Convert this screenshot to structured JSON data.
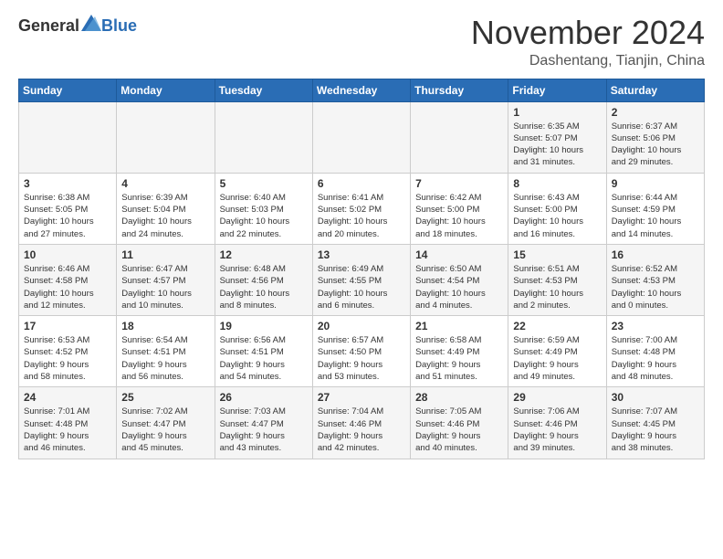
{
  "header": {
    "logo_general": "General",
    "logo_blue": "Blue",
    "month": "November 2024",
    "location": "Dashentang, Tianjin, China"
  },
  "weekdays": [
    "Sunday",
    "Monday",
    "Tuesday",
    "Wednesday",
    "Thursday",
    "Friday",
    "Saturday"
  ],
  "weeks": [
    [
      {
        "day": "",
        "info": ""
      },
      {
        "day": "",
        "info": ""
      },
      {
        "day": "",
        "info": ""
      },
      {
        "day": "",
        "info": ""
      },
      {
        "day": "",
        "info": ""
      },
      {
        "day": "1",
        "info": "Sunrise: 6:35 AM\nSunset: 5:07 PM\nDaylight: 10 hours\nand 31 minutes."
      },
      {
        "day": "2",
        "info": "Sunrise: 6:37 AM\nSunset: 5:06 PM\nDaylight: 10 hours\nand 29 minutes."
      }
    ],
    [
      {
        "day": "3",
        "info": "Sunrise: 6:38 AM\nSunset: 5:05 PM\nDaylight: 10 hours\nand 27 minutes."
      },
      {
        "day": "4",
        "info": "Sunrise: 6:39 AM\nSunset: 5:04 PM\nDaylight: 10 hours\nand 24 minutes."
      },
      {
        "day": "5",
        "info": "Sunrise: 6:40 AM\nSunset: 5:03 PM\nDaylight: 10 hours\nand 22 minutes."
      },
      {
        "day": "6",
        "info": "Sunrise: 6:41 AM\nSunset: 5:02 PM\nDaylight: 10 hours\nand 20 minutes."
      },
      {
        "day": "7",
        "info": "Sunrise: 6:42 AM\nSunset: 5:00 PM\nDaylight: 10 hours\nand 18 minutes."
      },
      {
        "day": "8",
        "info": "Sunrise: 6:43 AM\nSunset: 5:00 PM\nDaylight: 10 hours\nand 16 minutes."
      },
      {
        "day": "9",
        "info": "Sunrise: 6:44 AM\nSunset: 4:59 PM\nDaylight: 10 hours\nand 14 minutes."
      }
    ],
    [
      {
        "day": "10",
        "info": "Sunrise: 6:46 AM\nSunset: 4:58 PM\nDaylight: 10 hours\nand 12 minutes."
      },
      {
        "day": "11",
        "info": "Sunrise: 6:47 AM\nSunset: 4:57 PM\nDaylight: 10 hours\nand 10 minutes."
      },
      {
        "day": "12",
        "info": "Sunrise: 6:48 AM\nSunset: 4:56 PM\nDaylight: 10 hours\nand 8 minutes."
      },
      {
        "day": "13",
        "info": "Sunrise: 6:49 AM\nSunset: 4:55 PM\nDaylight: 10 hours\nand 6 minutes."
      },
      {
        "day": "14",
        "info": "Sunrise: 6:50 AM\nSunset: 4:54 PM\nDaylight: 10 hours\nand 4 minutes."
      },
      {
        "day": "15",
        "info": "Sunrise: 6:51 AM\nSunset: 4:53 PM\nDaylight: 10 hours\nand 2 minutes."
      },
      {
        "day": "16",
        "info": "Sunrise: 6:52 AM\nSunset: 4:53 PM\nDaylight: 10 hours\nand 0 minutes."
      }
    ],
    [
      {
        "day": "17",
        "info": "Sunrise: 6:53 AM\nSunset: 4:52 PM\nDaylight: 9 hours\nand 58 minutes."
      },
      {
        "day": "18",
        "info": "Sunrise: 6:54 AM\nSunset: 4:51 PM\nDaylight: 9 hours\nand 56 minutes."
      },
      {
        "day": "19",
        "info": "Sunrise: 6:56 AM\nSunset: 4:51 PM\nDaylight: 9 hours\nand 54 minutes."
      },
      {
        "day": "20",
        "info": "Sunrise: 6:57 AM\nSunset: 4:50 PM\nDaylight: 9 hours\nand 53 minutes."
      },
      {
        "day": "21",
        "info": "Sunrise: 6:58 AM\nSunset: 4:49 PM\nDaylight: 9 hours\nand 51 minutes."
      },
      {
        "day": "22",
        "info": "Sunrise: 6:59 AM\nSunset: 4:49 PM\nDaylight: 9 hours\nand 49 minutes."
      },
      {
        "day": "23",
        "info": "Sunrise: 7:00 AM\nSunset: 4:48 PM\nDaylight: 9 hours\nand 48 minutes."
      }
    ],
    [
      {
        "day": "24",
        "info": "Sunrise: 7:01 AM\nSunset: 4:48 PM\nDaylight: 9 hours\nand 46 minutes."
      },
      {
        "day": "25",
        "info": "Sunrise: 7:02 AM\nSunset: 4:47 PM\nDaylight: 9 hours\nand 45 minutes."
      },
      {
        "day": "26",
        "info": "Sunrise: 7:03 AM\nSunset: 4:47 PM\nDaylight: 9 hours\nand 43 minutes."
      },
      {
        "day": "27",
        "info": "Sunrise: 7:04 AM\nSunset: 4:46 PM\nDaylight: 9 hours\nand 42 minutes."
      },
      {
        "day": "28",
        "info": "Sunrise: 7:05 AM\nSunset: 4:46 PM\nDaylight: 9 hours\nand 40 minutes."
      },
      {
        "day": "29",
        "info": "Sunrise: 7:06 AM\nSunset: 4:46 PM\nDaylight: 9 hours\nand 39 minutes."
      },
      {
        "day": "30",
        "info": "Sunrise: 7:07 AM\nSunset: 4:45 PM\nDaylight: 9 hours\nand 38 minutes."
      }
    ]
  ]
}
